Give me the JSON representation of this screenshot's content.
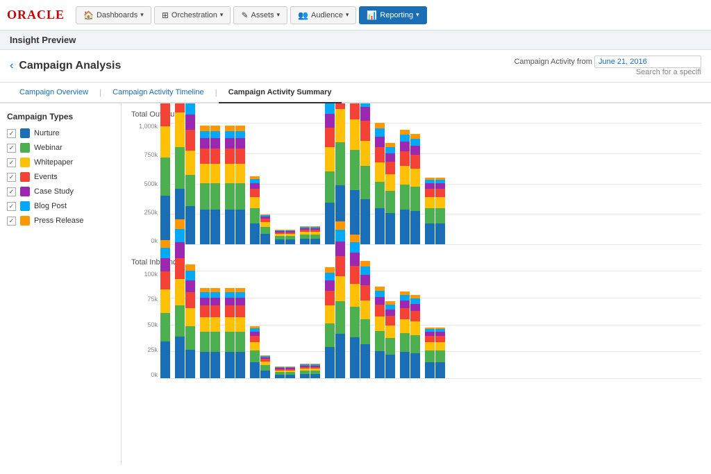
{
  "navbar": {
    "logo": "ORACLE",
    "items": [
      {
        "id": "dashboards",
        "label": "Dashboards",
        "icon": "🏠",
        "active": false
      },
      {
        "id": "orchestration",
        "label": "Orchestration",
        "icon": "⊞",
        "active": false
      },
      {
        "id": "assets",
        "label": "Assets",
        "icon": "✎",
        "active": false
      },
      {
        "id": "audience",
        "label": "Audience",
        "icon": "👥",
        "active": false
      },
      {
        "id": "reporting",
        "label": "Reporting",
        "icon": "📊",
        "active": true
      }
    ]
  },
  "page": {
    "header": "Insight Preview",
    "back_label": "Campaign Analysis",
    "date_label": "Campaign Activity from",
    "date_value": "June 21, 2016",
    "search_hint": "Search for a specifi"
  },
  "tabs": [
    {
      "id": "overview",
      "label": "Campaign Overview",
      "active": false
    },
    {
      "id": "timeline",
      "label": "Campaign Activity Timeline",
      "active": false
    },
    {
      "id": "summary",
      "label": "Campaign Activity Summary",
      "active": true
    }
  ],
  "sidebar": {
    "title": "Campaign Types",
    "items": [
      {
        "label": "Nurture",
        "color": "#1a6eb5"
      },
      {
        "label": "Webinar",
        "color": "#4caf50"
      },
      {
        "label": "Whitepaper",
        "color": "#ffc107"
      },
      {
        "label": "Events",
        "color": "#f44336"
      },
      {
        "label": "Case Study",
        "color": "#9c27b0"
      },
      {
        "label": "Blog Post",
        "color": "#03a9f4"
      },
      {
        "label": "Press Release",
        "color": "#ff9800"
      }
    ]
  },
  "charts": {
    "outbound": {
      "title": "Total Outbound",
      "y_labels": [
        "0k",
        "250k",
        "500k",
        "750k",
        "1,000k"
      ],
      "height": 175
    },
    "inbound": {
      "title": "Total Inbound",
      "y_labels": [
        "0k",
        "25k",
        "50k",
        "75k",
        "100k"
      ],
      "height": 155
    }
  }
}
